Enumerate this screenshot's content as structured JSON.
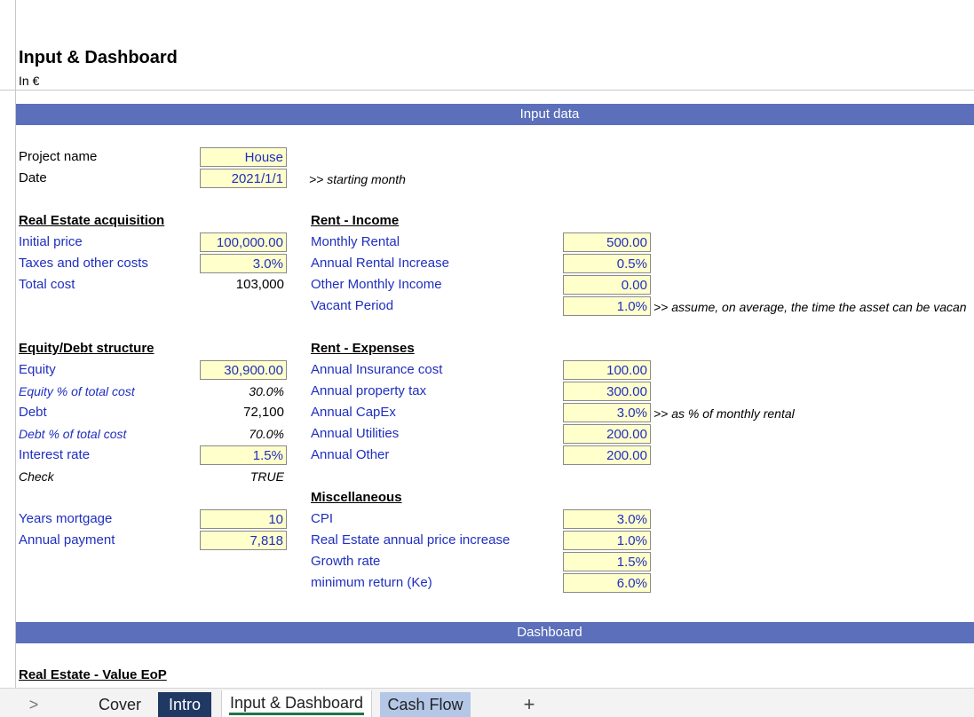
{
  "sheet": {
    "title": "Input & Dashboard",
    "subtitle": "In €",
    "section_input": "Input data",
    "section_dashboard": "Dashboard"
  },
  "project": {
    "name_label": "Project name",
    "name_value": "House",
    "date_label": "Date",
    "date_value": "2021/1/1",
    "date_note": ">> starting month"
  },
  "acquisition": {
    "heading": "Real Estate acquisition",
    "initial_price_label": "Initial price",
    "initial_price_value": "100,000.00",
    "taxes_label": "Taxes and other costs",
    "taxes_value": "3.0%",
    "total_label": "Total cost",
    "total_value": "103,000"
  },
  "equity_debt": {
    "heading": "Equity/Debt structure",
    "equity_label": "Equity",
    "equity_value": "30,900.00",
    "equity_pct_label": "Equity % of total cost",
    "equity_pct_value": "30.0%",
    "debt_label": "Debt",
    "debt_value": "72,100",
    "debt_pct_label": "Debt % of total cost",
    "debt_pct_value": "70.0%",
    "interest_label": "Interest rate",
    "interest_value": "1.5%",
    "check_label": "Check",
    "check_value": "TRUE",
    "years_label": "Years mortgage",
    "years_value": "10",
    "payment_label": "Annual payment",
    "payment_value": "7,818"
  },
  "rent_income": {
    "heading": "Rent - Income",
    "monthly_label": "Monthly Rental",
    "monthly_value": "500.00",
    "increase_label": "Annual Rental Increase",
    "increase_value": "0.5%",
    "other_label": "Other Monthly Income",
    "other_value": "0.00",
    "vacant_label": "Vacant Period",
    "vacant_value": "1.0%",
    "vacant_note": ">> assume, on average, the time the asset can be vacan"
  },
  "rent_expenses": {
    "heading": "Rent - Expenses",
    "insurance_label": "Annual Insurance cost",
    "insurance_value": "100.00",
    "tax_label": "Annual property tax",
    "tax_value": "300.00",
    "capex_label": "Annual CapEx",
    "capex_value": "3.0%",
    "capex_note": ">> as % of monthly rental",
    "utilities_label": "Annual Utilities",
    "utilities_value": "200.00",
    "other_label": "Annual Other",
    "other_value": "200.00"
  },
  "misc": {
    "heading": "Miscellaneous",
    "cpi_label": "CPI",
    "cpi_value": "3.0%",
    "re_increase_label": "Real Estate annual price increase",
    "re_increase_value": "1.0%",
    "growth_label": "Growth rate",
    "growth_value": "1.5%",
    "ke_label": "minimum return (Ke)",
    "ke_value": "6.0%"
  },
  "dashboard": {
    "first_heading": "Real Estate - Value EoP"
  },
  "tabs": {
    "nav": ">",
    "cover": "Cover",
    "intro": "Intro",
    "input": "Input & Dashboard",
    "cash": "Cash Flow",
    "add": "+"
  },
  "colors": {
    "band": "#5b6fba",
    "input_fill": "#ffffcc",
    "input_text": "#1f2fbf",
    "active_tab_underline": "#217346",
    "intro_tab": "#1f3864",
    "cash_tab": "#b4c7e7"
  }
}
